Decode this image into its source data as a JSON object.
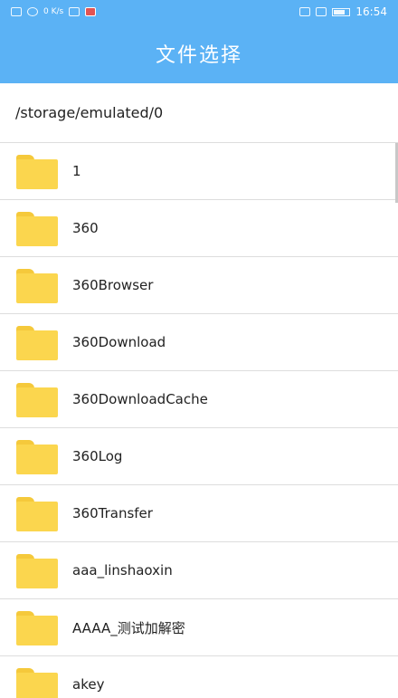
{
  "status_bar": {
    "time": "16:54",
    "speed": "0 K/s"
  },
  "header": {
    "title": "文件选择"
  },
  "path": "/storage/emulated/0",
  "folders": [
    {
      "name": "1",
      "icon": "folder-icon"
    },
    {
      "name": "360",
      "icon": "folder-icon"
    },
    {
      "name": "360Browser",
      "icon": "folder-icon"
    },
    {
      "name": "360Download",
      "icon": "folder-icon"
    },
    {
      "name": "360DownloadCache",
      "icon": "folder-icon"
    },
    {
      "name": "360Log",
      "icon": "folder-icon"
    },
    {
      "name": "360Transfer",
      "icon": "folder-icon"
    },
    {
      "name": "aaa_linshaoxin",
      "icon": "folder-icon"
    },
    {
      "name": "AAAA_测试加解密",
      "icon": "folder-icon"
    },
    {
      "name": "akey",
      "icon": "folder-icon"
    }
  ],
  "colors": {
    "appbar": "#5bb2f5",
    "folder": "#fbd64e",
    "divider": "#dddddd"
  }
}
